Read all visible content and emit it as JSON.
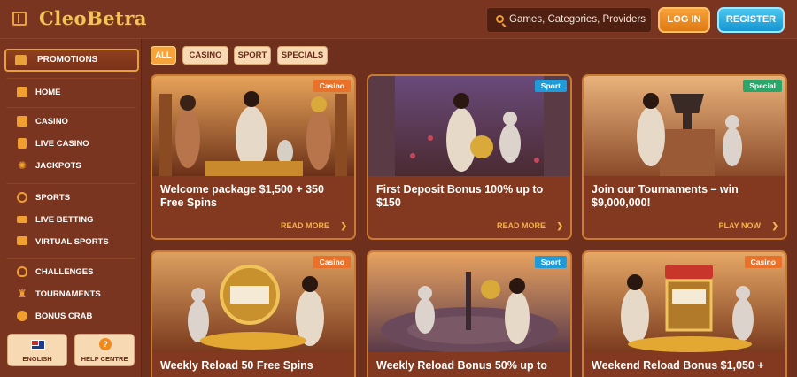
{
  "header": {
    "logo_text": "CleoBetra",
    "search_placeholder": "Games, Categories, Providers",
    "login_label": "LOG IN",
    "register_label": "REGISTER"
  },
  "sidebar": {
    "promotions_label": "PROMOTIONS",
    "items": [
      {
        "label": "HOME",
        "icon": "home-icon"
      },
      {
        "label": "CASINO",
        "icon": "casino-icon"
      },
      {
        "label": "LIVE CASINO",
        "icon": "live-casino-icon"
      },
      {
        "label": "JACKPOTS",
        "icon": "jackpots-icon"
      },
      {
        "label": "SPORTS",
        "icon": "sports-icon"
      },
      {
        "label": "LIVE BETTING",
        "icon": "live-betting-icon"
      },
      {
        "label": "VIRTUAL SPORTS",
        "icon": "virtual-sports-icon"
      },
      {
        "label": "CHALLENGES",
        "icon": "challenges-icon"
      },
      {
        "label": "TOURNAMENTS",
        "icon": "trophy-icon"
      },
      {
        "label": "BONUS CRAB",
        "icon": "bonus-crab-icon"
      }
    ],
    "language_label": "ENGLISH",
    "help_label": "HELP CENTRE"
  },
  "filters": [
    "ALL",
    "CASINO",
    "SPORT",
    "SPECIALS"
  ],
  "active_filter": "ALL",
  "cards": [
    {
      "badge": "Casino",
      "title": "Welcome package $1,500 + 350 Free Spins",
      "cta": "READ MORE"
    },
    {
      "badge": "Sport",
      "title": "First Deposit Bonus 100% up to $150",
      "cta": "READ MORE"
    },
    {
      "badge": "Special",
      "title": "Join our Tournaments – win $9,000,000!",
      "cta": "PLAY NOW"
    },
    {
      "badge": "Casino",
      "title": "Weekly Reload 50 Free Spins",
      "cta": ""
    },
    {
      "badge": "Sport",
      "title": "Weekly Reload Bonus 50% up to",
      "cta": ""
    },
    {
      "badge": "Casino",
      "title": "Weekend Reload Bonus $1,050 +",
      "cta": ""
    }
  ],
  "colors": {
    "background": "#6e2f1c",
    "accent_orange": "#f6a33a",
    "accent_blue": "#1e9bd8",
    "badge_casino": "#e9712a",
    "badge_sport": "#1e9bd8",
    "badge_special": "#2aa66a"
  }
}
